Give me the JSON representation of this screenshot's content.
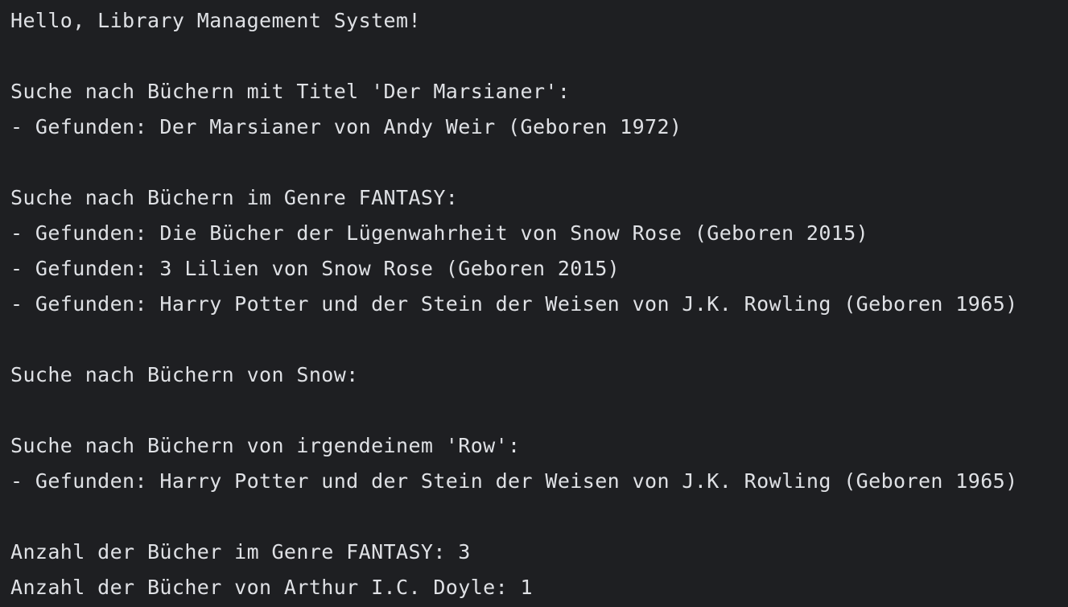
{
  "console": {
    "lines": [
      "Hello, Library Management System!",
      "",
      "Suche nach Büchern mit Titel 'Der Marsianer':",
      "- Gefunden: Der Marsianer von Andy Weir (Geboren 1972)",
      "",
      "Suche nach Büchern im Genre FANTASY:",
      "- Gefunden: Die Bücher der Lügenwahrheit von Snow Rose (Geboren 2015)",
      "- Gefunden: 3 Lilien von Snow Rose (Geboren 2015)",
      "- Gefunden: Harry Potter und der Stein der Weisen von J.K. Rowling (Geboren 1965)",
      "",
      "Suche nach Büchern von Snow:",
      "",
      "Suche nach Büchern von irgendeinem 'Row':",
      "- Gefunden: Harry Potter und der Stein der Weisen von J.K. Rowling (Geboren 1965)",
      "",
      "Anzahl der Bücher im Genre FANTASY: 3",
      "Anzahl der Bücher von Arthur I.C. Doyle: 1"
    ]
  },
  "colors": {
    "background": "#1e1f22",
    "text": "#dfe1e5"
  }
}
